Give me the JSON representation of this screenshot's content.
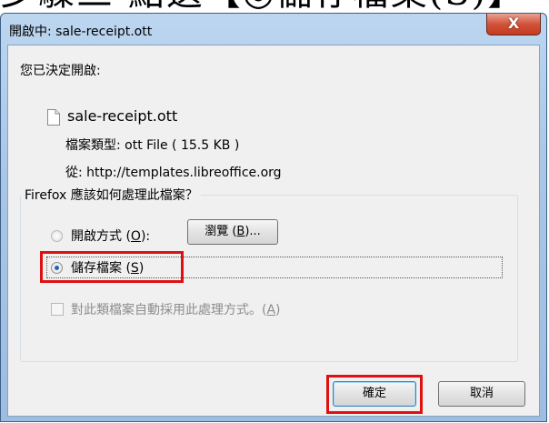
{
  "banner": {
    "text": "步驟三 點選【◎儲存檔案(S)】→【確定】"
  },
  "window": {
    "title": "開啟中: sale-receipt.ott",
    "close_symbol": "X"
  },
  "dialog": {
    "intro": "您已決定開啟:",
    "filename": "sale-receipt.ott",
    "file_type_label": "檔案類型:",
    "file_type_value": "ott File ( 15.5 KB )",
    "from_label": "從:",
    "from_value": "http://templates.libreoffice.org",
    "question": "Firefox 應該如何處理此檔案？",
    "open_with": {
      "label": "開啟方式 (",
      "accel": "O",
      "suffix": "):"
    },
    "browse_button": {
      "label": "瀏覽 (",
      "accel": "B",
      "suffix": ")..."
    },
    "save_file": {
      "label": "儲存檔案 (",
      "accel": "S",
      "suffix": ")"
    },
    "auto_checkbox": {
      "label": "對此類檔案自動採用此處理方式。(",
      "accel": "A",
      "suffix": ")"
    },
    "ok_button": "確定",
    "cancel_button": "取消"
  },
  "icons": {
    "file": "file-icon",
    "close": "close-icon"
  },
  "colors": {
    "highlight": "#e01010",
    "radio_selected": "#2560b8"
  },
  "state": {
    "selected_option": "save_file",
    "auto_checked": false
  }
}
